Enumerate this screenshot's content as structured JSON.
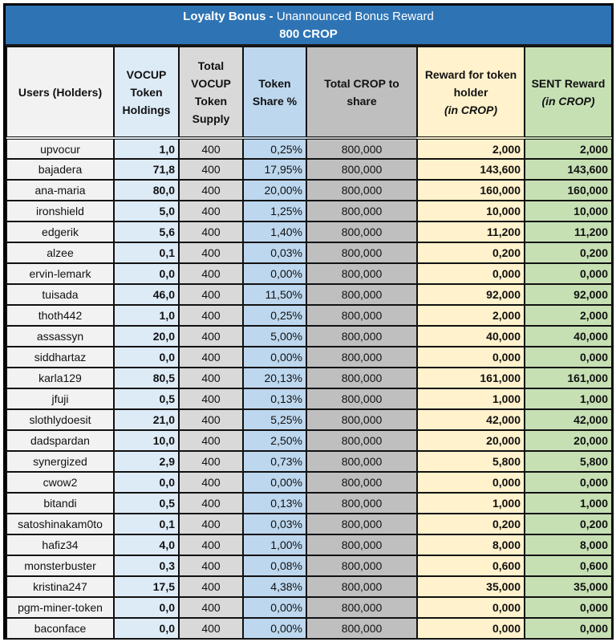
{
  "title": {
    "bold_part": "Loyalty Bonus -",
    "normal_part": " Unannounced Bonus Reward",
    "subtitle": "800 CROP"
  },
  "colors": {
    "title_band": "#2e74b5",
    "users": "#f2f2f2",
    "holdings": "#ddebf7",
    "supply": "#d9d9d9",
    "share": "#bdd7ee",
    "total": "#bfbfbf",
    "reward": "#fff2cc",
    "sent": "#c6e0b4"
  },
  "headers": {
    "users": "Users (Holders)",
    "holdings": "VOCUP Token Holdings",
    "supply": "Total VOCUP Token Supply",
    "share": "Token Share %",
    "total": "Total CROP to share",
    "reward_main": "Reward for token holder",
    "reward_unit": "(in CROP)",
    "sent_main": "SENT Reward",
    "sent_unit": "(in CROP)"
  },
  "rows": [
    {
      "user": "upvocur",
      "holdings": "1,0",
      "supply": "400",
      "share": "0,25%",
      "total": "800,000",
      "reward": "2,000",
      "sent": "2,000"
    },
    {
      "user": "bajadera",
      "holdings": "71,8",
      "supply": "400",
      "share": "17,95%",
      "total": "800,000",
      "reward": "143,600",
      "sent": "143,600"
    },
    {
      "user": "ana-maria",
      "holdings": "80,0",
      "supply": "400",
      "share": "20,00%",
      "total": "800,000",
      "reward": "160,000",
      "sent": "160,000"
    },
    {
      "user": "ironshield",
      "holdings": "5,0",
      "supply": "400",
      "share": "1,25%",
      "total": "800,000",
      "reward": "10,000",
      "sent": "10,000"
    },
    {
      "user": "edgerik",
      "holdings": "5,6",
      "supply": "400",
      "share": "1,40%",
      "total": "800,000",
      "reward": "11,200",
      "sent": "11,200"
    },
    {
      "user": "alzee",
      "holdings": "0,1",
      "supply": "400",
      "share": "0,03%",
      "total": "800,000",
      "reward": "0,200",
      "sent": "0,200"
    },
    {
      "user": "ervin-lemark",
      "holdings": "0,0",
      "supply": "400",
      "share": "0,00%",
      "total": "800,000",
      "reward": "0,000",
      "sent": "0,000"
    },
    {
      "user": "tuisada",
      "holdings": "46,0",
      "supply": "400",
      "share": "11,50%",
      "total": "800,000",
      "reward": "92,000",
      "sent": "92,000"
    },
    {
      "user": "thoth442",
      "holdings": "1,0",
      "supply": "400",
      "share": "0,25%",
      "total": "800,000",
      "reward": "2,000",
      "sent": "2,000"
    },
    {
      "user": "assassyn",
      "holdings": "20,0",
      "supply": "400",
      "share": "5,00%",
      "total": "800,000",
      "reward": "40,000",
      "sent": "40,000"
    },
    {
      "user": "siddhartaz",
      "holdings": "0,0",
      "supply": "400",
      "share": "0,00%",
      "total": "800,000",
      "reward": "0,000",
      "sent": "0,000"
    },
    {
      "user": "karla129",
      "holdings": "80,5",
      "supply": "400",
      "share": "20,13%",
      "total": "800,000",
      "reward": "161,000",
      "sent": "161,000"
    },
    {
      "user": "jfuji",
      "holdings": "0,5",
      "supply": "400",
      "share": "0,13%",
      "total": "800,000",
      "reward": "1,000",
      "sent": "1,000"
    },
    {
      "user": "slothlydoesit",
      "holdings": "21,0",
      "supply": "400",
      "share": "5,25%",
      "total": "800,000",
      "reward": "42,000",
      "sent": "42,000"
    },
    {
      "user": "dadspardan",
      "holdings": "10,0",
      "supply": "400",
      "share": "2,50%",
      "total": "800,000",
      "reward": "20,000",
      "sent": "20,000"
    },
    {
      "user": "synergized",
      "holdings": "2,9",
      "supply": "400",
      "share": "0,73%",
      "total": "800,000",
      "reward": "5,800",
      "sent": "5,800"
    },
    {
      "user": "cwow2",
      "holdings": "0,0",
      "supply": "400",
      "share": "0,00%",
      "total": "800,000",
      "reward": "0,000",
      "sent": "0,000"
    },
    {
      "user": "bitandi",
      "holdings": "0,5",
      "supply": "400",
      "share": "0,13%",
      "total": "800,000",
      "reward": "1,000",
      "sent": "1,000"
    },
    {
      "user": "satoshinakam0to",
      "holdings": "0,1",
      "supply": "400",
      "share": "0,03%",
      "total": "800,000",
      "reward": "0,200",
      "sent": "0,200"
    },
    {
      "user": "hafiz34",
      "holdings": "4,0",
      "supply": "400",
      "share": "1,00%",
      "total": "800,000",
      "reward": "8,000",
      "sent": "8,000"
    },
    {
      "user": "monsterbuster",
      "holdings": "0,3",
      "supply": "400",
      "share": "0,08%",
      "total": "800,000",
      "reward": "0,600",
      "sent": "0,600"
    },
    {
      "user": "kristina247",
      "holdings": "17,5",
      "supply": "400",
      "share": "4,38%",
      "total": "800,000",
      "reward": "35,000",
      "sent": "35,000"
    },
    {
      "user": "pgm-miner-token",
      "holdings": "0,0",
      "supply": "400",
      "share": "0,00%",
      "total": "800,000",
      "reward": "0,000",
      "sent": "0,000"
    },
    {
      "user": "baconface",
      "holdings": "0,0",
      "supply": "400",
      "share": "0,00%",
      "total": "800,000",
      "reward": "0,000",
      "sent": "0,000"
    }
  ]
}
